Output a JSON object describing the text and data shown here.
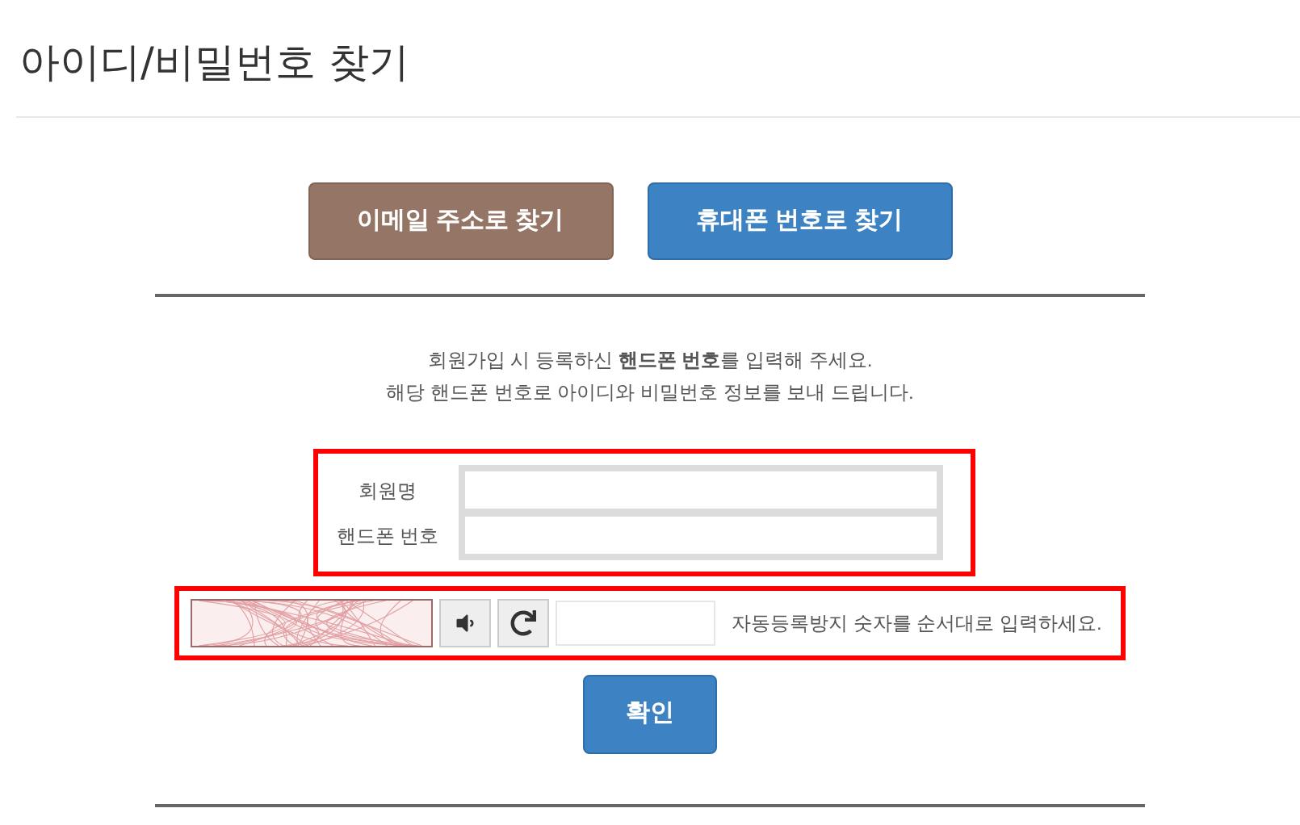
{
  "title": "아이디/비밀번호 찾기",
  "tabs": [
    {
      "label": "이메일 주소로 찾기",
      "selected": false
    },
    {
      "label": "휴대폰 번호로 찾기",
      "selected": true
    }
  ],
  "intro": [
    "회원가입 시 등록하신 **핸드폰 번호**를 입력해 주세요.",
    "해당 핸드폰 번호로 아이디와 비밀번호 정보를 보내 드립니다."
  ],
  "fields": [
    {
      "label": "회원명"
    },
    {
      "label": "핸드폰 번호"
    }
  ],
  "captcha": {
    "kind": "picture",
    "hint": "자동등록방지 숫자를 순서대로 입력하세요."
  },
  "submit": "확인"
}
